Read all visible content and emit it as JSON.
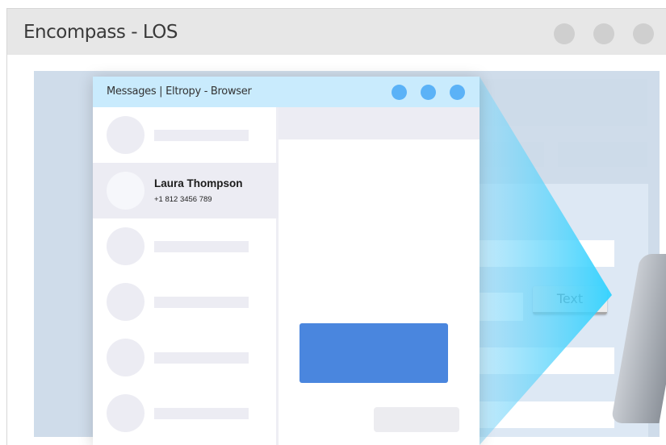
{
  "los_window": {
    "title": "Encompass - LOS",
    "text_button_label": "Text",
    "colors": {
      "titlebar": "#e7e7e7",
      "page_background": "#cfdcea",
      "window_dot": "#cfcfcf"
    }
  },
  "eltropy_window": {
    "title": "Messages | Eltropy  - Browser",
    "selected_contact": {
      "name": "Laura Thompson",
      "phone": "+1 812 3456 789"
    },
    "colors": {
      "titlebar": "#c9ebfd",
      "window_dot": "#5bb2f7",
      "outgoing_bubble": "#4a86de",
      "incoming_bubble": "#ececf0",
      "placeholder": "#ececf3"
    }
  },
  "beam": {
    "colors": [
      "#8fd8f8",
      "#2fd2ff"
    ]
  },
  "icons": [
    "window-control-dot",
    "contact-avatar"
  ]
}
